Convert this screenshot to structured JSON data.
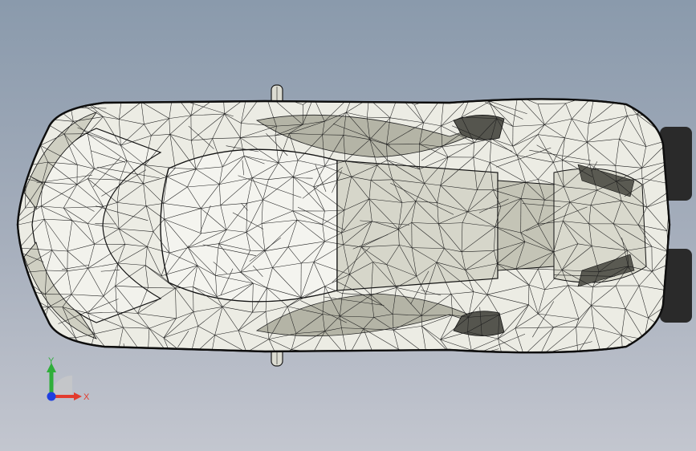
{
  "viewport": {
    "background_top": "#8a9aac",
    "background_bottom": "#c3c6cf",
    "model": {
      "name": "sports-car-wireframe",
      "view": "top",
      "body_fill": "#e9e9e2",
      "shade_fill": "#c9c9bd",
      "dark_fill": "#6f6f66",
      "edge_color": "#1a1a1a"
    }
  },
  "triad": {
    "x_label": "X",
    "y_label": "Y",
    "x_color": "#e23b2e",
    "y_color": "#2fae3a",
    "z_color": "#1f3fe0"
  }
}
